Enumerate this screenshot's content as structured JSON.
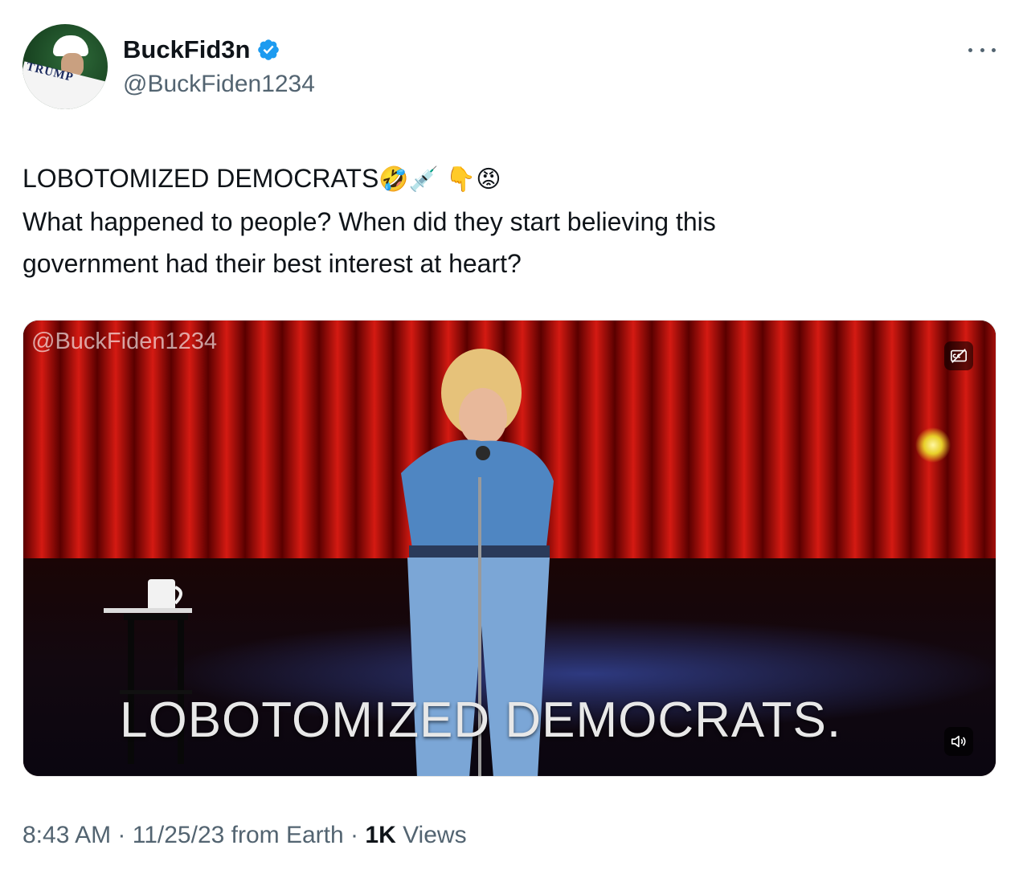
{
  "author": {
    "display_name": "BuckFid3n",
    "handle": "@BuckFiden1234",
    "verified": true,
    "avatar_text": "TRUMP"
  },
  "tweet": {
    "line1_text": "LOBOTOMIZED DEMOCRATS",
    "line1_emojis": [
      "🤣",
      "💉",
      "👇",
      "😡"
    ],
    "line2": "What happened to people? When did they start believing this",
    "line3": "government had their best interest at heart?"
  },
  "media": {
    "watermark": "@BuckFiden1234",
    "caption": "LOBOTOMIZED DEMOCRATS."
  },
  "meta": {
    "time": "8:43 AM",
    "separator": "·",
    "date_source": "11/25/23 from Earth",
    "views_count": "1K",
    "views_label": "Views"
  },
  "colors": {
    "verified_blue": "#1d9bf0",
    "secondary_text": "#536471",
    "primary_text": "#0f1419"
  },
  "icons": {
    "verified": "verified-badge-icon",
    "more": "more-options-icon",
    "captions": "captions-off-icon",
    "volume": "volume-icon"
  }
}
